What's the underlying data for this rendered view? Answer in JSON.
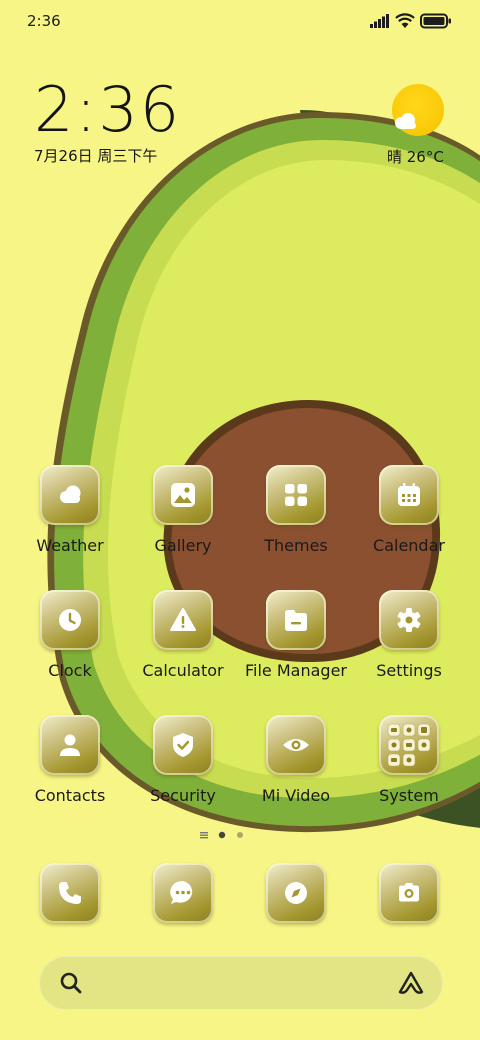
{
  "status_bar": {
    "time": "2:36",
    "icons": [
      "signal-icon",
      "wifi-icon",
      "battery-icon"
    ]
  },
  "clock_widget": {
    "time": "2:36",
    "date": "7月26日 周三下午"
  },
  "weather_widget": {
    "text": "晴 26°C",
    "icon": "partly-sunny-icon"
  },
  "apps": [
    {
      "name": "Weather",
      "icon": "weather-cloud-icon"
    },
    {
      "name": "Gallery",
      "icon": "gallery-icon"
    },
    {
      "name": "Themes",
      "icon": "themes-grid-icon"
    },
    {
      "name": "Calendar",
      "icon": "calendar-icon"
    },
    {
      "name": "Clock",
      "icon": "clock-icon"
    },
    {
      "name": "Calculator",
      "icon": "calculator-icon"
    },
    {
      "name": "File Manager",
      "icon": "folder-icon"
    },
    {
      "name": "Settings",
      "icon": "gear-icon"
    },
    {
      "name": "Contacts",
      "icon": "person-icon"
    },
    {
      "name": "Security",
      "icon": "shield-check-icon"
    },
    {
      "name": "Mi Video",
      "icon": "eye-icon"
    },
    {
      "name": "System",
      "icon": "folder-grid-icon"
    }
  ],
  "page_indicator": {
    "pages": 2,
    "current": 1
  },
  "dock": [
    {
      "name": "Phone",
      "icon": "phone-icon"
    },
    {
      "name": "Messages",
      "icon": "chat-icon"
    },
    {
      "name": "Browser",
      "icon": "compass-icon"
    },
    {
      "name": "Camera",
      "icon": "camera-icon"
    }
  ],
  "search": {
    "icon": "search-icon",
    "assistant_icon": "assistant-icon"
  },
  "colors": {
    "background": "#f6f586",
    "avocado_skin": "#4f6a2b",
    "avocado_flesh": "#d9ea5a",
    "pit": "#8b5030",
    "icon_tile": "#b0a440",
    "sun": "#ffd21a"
  }
}
